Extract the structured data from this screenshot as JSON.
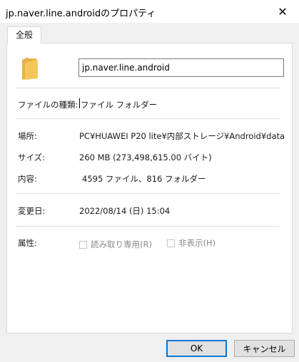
{
  "window": {
    "title": "jp.naver.line.androidのプロパティ",
    "close_glyph": "✕"
  },
  "tabs": [
    {
      "label": "全般",
      "selected": true
    }
  ],
  "general": {
    "name_value": "jp.naver.line.android",
    "type_label": "ファイルの種類:",
    "type_value": "ファイル フォルダー",
    "location_label": "場所:",
    "location_value": "PC¥HUAWEI P20 lite¥内部ストレージ¥Android¥data",
    "size_label": "サイズ:",
    "size_value": "260 MB (273,498,615.00 バイト)",
    "contents_label": "内容:",
    "contents_value": "4595 ファイル、816 フォルダー",
    "modified_label": "変更日:",
    "modified_value": "2022/08/14 (日) 15:04",
    "attributes_label": "属性:",
    "readonly_label": "読み取り専用(R)",
    "readonly_checked": false,
    "hidden_label": "非表示(H)",
    "hidden_checked": false
  },
  "buttons": {
    "ok": "OK",
    "cancel": "キャンセル"
  },
  "colors": {
    "folder": "#f5c75b",
    "accent": "#0078d7"
  }
}
